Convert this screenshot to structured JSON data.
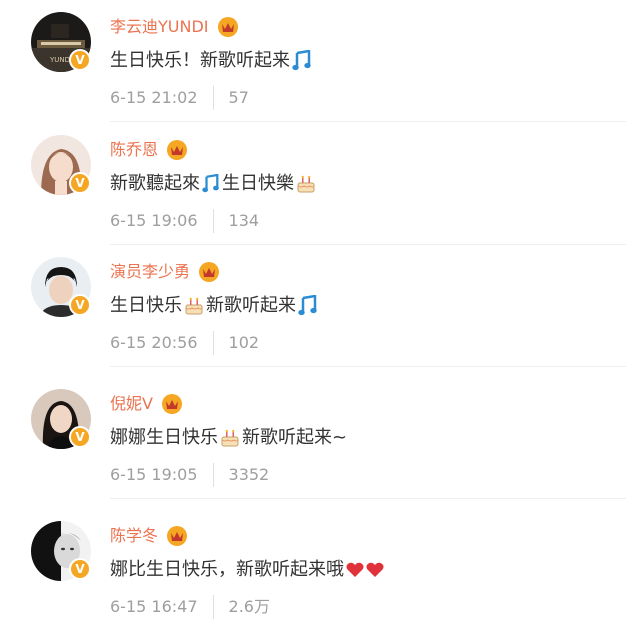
{
  "colors": {
    "username": "#eb7350",
    "content": "#333333",
    "meta": "#9e9e9e",
    "verified_badge": "#f5a623",
    "music_note": "#2a8dd4",
    "heart": "#e0323a"
  },
  "comments": [
    {
      "username": "李云迪YUNDI",
      "content_parts": [
        "生日快乐！新歌听起来",
        ""
      ],
      "emojis": [
        "music-note-emoji"
      ],
      "time": "6-15 21:02",
      "likes": "57",
      "avatar": "piano-avatar"
    },
    {
      "username": "陈乔恩",
      "content_parts": [
        "新歌聽起來",
        "生日快樂",
        ""
      ],
      "emojis": [
        "music-note-emoji",
        "cake-emoji"
      ],
      "time": "6-15 19:06",
      "likes": "134",
      "avatar": "woman-avatar"
    },
    {
      "username": "演员李少勇",
      "content_parts": [
        "生日快乐",
        "新歌听起来",
        ""
      ],
      "emojis": [
        "cake-emoji",
        "music-note-emoji"
      ],
      "time": "6-15 20:56",
      "likes": "102",
      "avatar": "man-avatar"
    },
    {
      "username": "倪妮V",
      "content_parts": [
        "娜娜生日快乐",
        "新歌听起来~"
      ],
      "emojis": [
        "cake-emoji"
      ],
      "time": "6-15 19:05",
      "likes": "3352",
      "avatar": "dark-hair-woman-avatar"
    },
    {
      "username": "陈学冬",
      "content_parts": [
        "娜比生日快乐，新歌听起来哦",
        ""
      ],
      "emojis": [
        "double-heart-emoji"
      ],
      "time": "6-15 16:47",
      "likes": "2.6万",
      "avatar": "bw-portrait-avatar"
    }
  ]
}
